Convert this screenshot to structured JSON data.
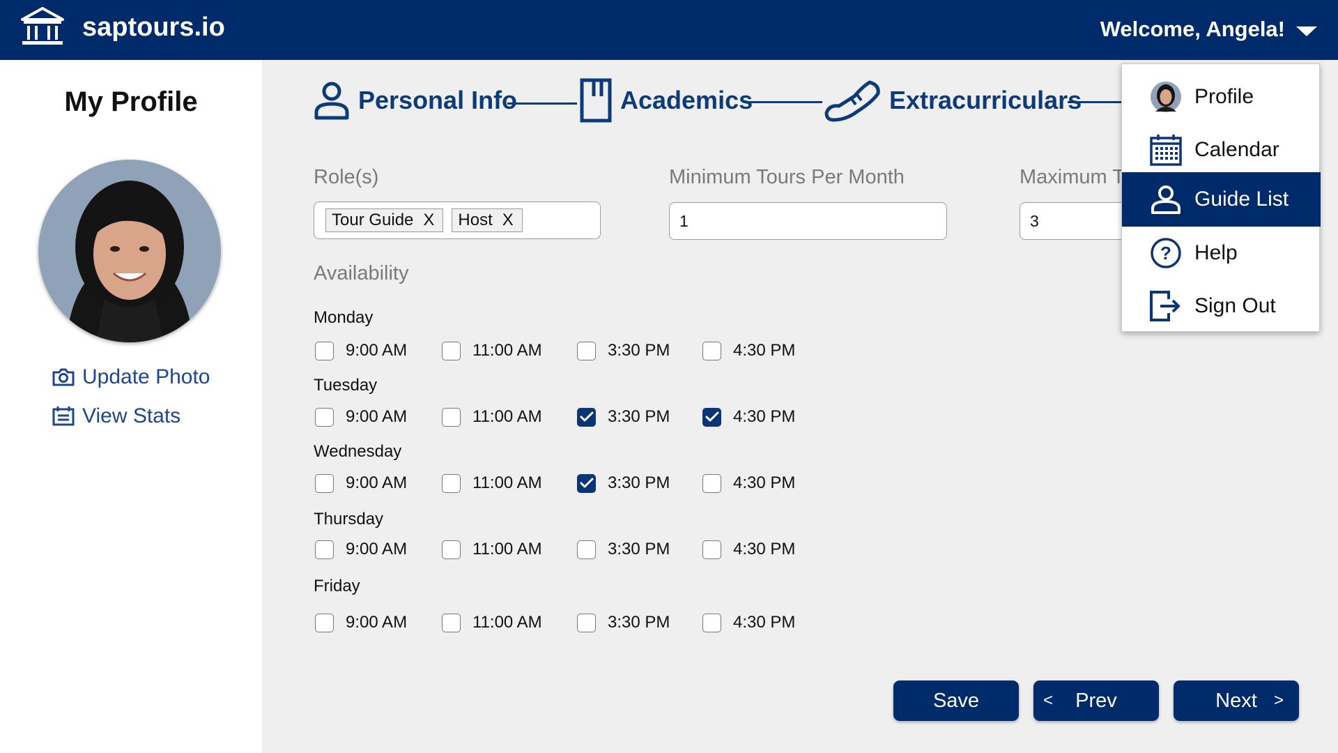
{
  "header": {
    "brand": "saptours.io",
    "welcome": "Welcome, Angela!"
  },
  "sidebar": {
    "title": "My Profile",
    "update_photo": "Update Photo",
    "view_stats": "View Stats"
  },
  "steps": [
    {
      "label": "Personal Info"
    },
    {
      "label": "Academics"
    },
    {
      "label": "Extracurriculars"
    }
  ],
  "form": {
    "roles_label": "Role(s)",
    "roles": [
      "Tour Guide",
      "Host"
    ],
    "tag_remove": "X",
    "min_tours_label": "Minimum Tours Per Month",
    "min_tours_value": "1",
    "max_tours_label": "Maximum T",
    "max_tours_value": "3",
    "availability_label": "Availability"
  },
  "availability": [
    {
      "day": "Monday",
      "slots": [
        {
          "time": "9:00 AM",
          "checked": false
        },
        {
          "time": "11:00 AM",
          "checked": false
        },
        {
          "time": "3:30 PM",
          "checked": false
        },
        {
          "time": "4:30 PM",
          "checked": false
        }
      ]
    },
    {
      "day": "Tuesday",
      "slots": [
        {
          "time": "9:00 AM",
          "checked": false
        },
        {
          "time": "11:00 AM",
          "checked": false
        },
        {
          "time": "3:30 PM",
          "checked": true
        },
        {
          "time": "4:30 PM",
          "checked": true
        }
      ]
    },
    {
      "day": "Wednesday",
      "slots": [
        {
          "time": "9:00 AM",
          "checked": false
        },
        {
          "time": "11:00 AM",
          "checked": false
        },
        {
          "time": "3:30 PM",
          "checked": true
        },
        {
          "time": "4:30 PM",
          "checked": false
        }
      ]
    },
    {
      "day": "Thursday",
      "slots": [
        {
          "time": "9:00 AM",
          "checked": false
        },
        {
          "time": "11:00 AM",
          "checked": false
        },
        {
          "time": "3:30 PM",
          "checked": false
        },
        {
          "time": "4:30 PM",
          "checked": false
        }
      ]
    },
    {
      "day": "Friday",
      "slots": [
        {
          "time": "9:00 AM",
          "checked": false
        },
        {
          "time": "11:00 AM",
          "checked": false
        },
        {
          "time": "3:30 PM",
          "checked": false
        },
        {
          "time": "4:30 PM",
          "checked": false
        }
      ]
    }
  ],
  "buttons": {
    "save": "Save",
    "prev": "Prev",
    "prev_arrow": "<",
    "next": "Next",
    "next_arrow": ">"
  },
  "menu": {
    "items": [
      {
        "label": "Profile",
        "icon": "avatar-icon",
        "active": false
      },
      {
        "label": "Calendar",
        "icon": "calendar-icon",
        "active": false
      },
      {
        "label": "Guide List",
        "icon": "person-icon",
        "active": true
      },
      {
        "label": "Help",
        "icon": "help-icon",
        "active": false
      },
      {
        "label": "Sign Out",
        "icon": "sign-out-icon",
        "active": false
      }
    ]
  },
  "colors": {
    "navy": "#002b6b",
    "link": "#1d4690",
    "background": "#efefef"
  }
}
